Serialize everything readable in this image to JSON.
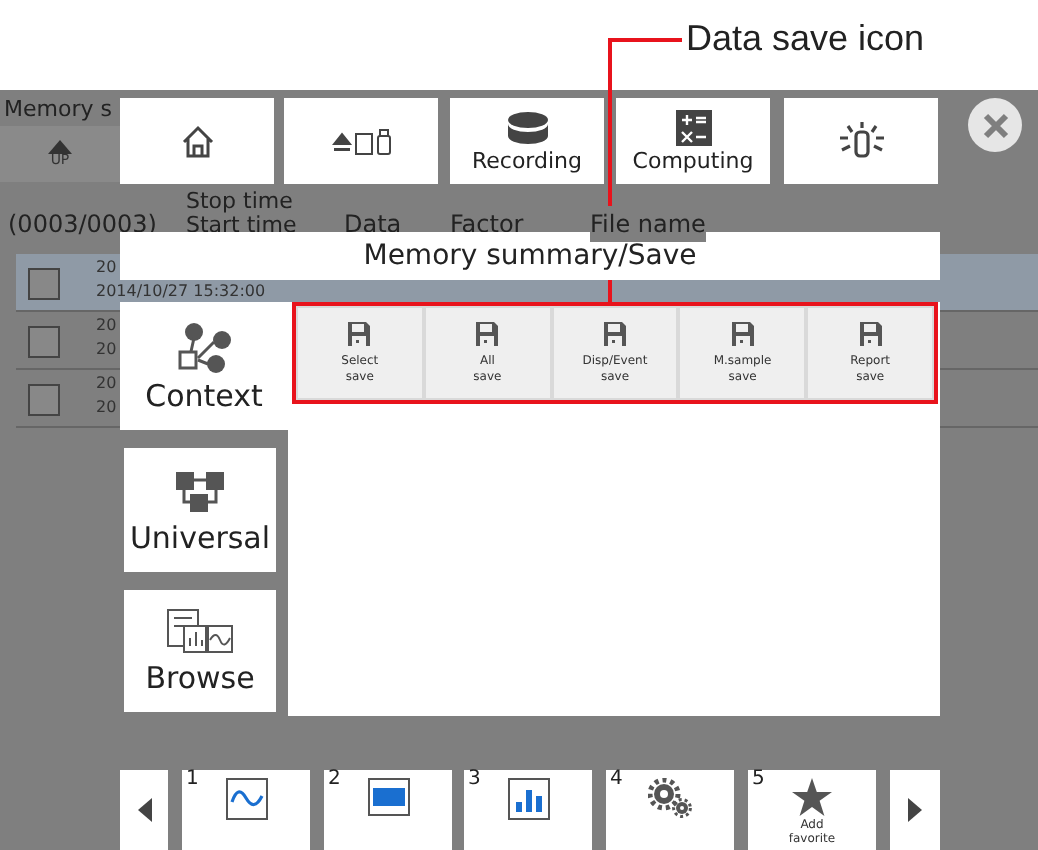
{
  "annotation": {
    "label": "Data save icon"
  },
  "background_screen": {
    "title": "Memory s",
    "up_button": "UP",
    "count": "(0003/0003)",
    "columns": [
      "Stop time",
      "Start time",
      "Data",
      "Factor",
      "File name"
    ],
    "rows": [
      {
        "stop": "20",
        "start": "2014/10/27 15:32:00",
        "selected": true
      },
      {
        "stop": "20",
        "start": "20",
        "selected": false
      },
      {
        "stop": "20",
        "start": "20",
        "selected": false
      }
    ]
  },
  "top_buttons": [
    {
      "kind": "home"
    },
    {
      "kind": "media"
    },
    {
      "kind": "recording",
      "label": "Recording"
    },
    {
      "kind": "computing",
      "label": "Computing"
    },
    {
      "kind": "light"
    }
  ],
  "dialog": {
    "title": "Memory summary/Save",
    "categories": [
      {
        "kind": "context",
        "label": "Context",
        "selected": true
      },
      {
        "kind": "universal",
        "label": "Universal",
        "selected": false
      },
      {
        "kind": "browse",
        "label": "Browse",
        "selected": false
      }
    ],
    "save_buttons": [
      {
        "line1": "Select",
        "line2": "save"
      },
      {
        "line1": "All",
        "line2": "save"
      },
      {
        "line1": "Disp/Event",
        "line2": "save"
      },
      {
        "line1": "M.sample",
        "line2": "save"
      },
      {
        "line1": "Report",
        "line2": "save"
      }
    ]
  },
  "favorites": [
    {
      "number": "1",
      "kind": "wave"
    },
    {
      "number": "2",
      "kind": "digits"
    },
    {
      "number": "3",
      "kind": "bars"
    },
    {
      "number": "4",
      "kind": "gears"
    },
    {
      "number": "5",
      "kind": "add",
      "label": "Add favorite"
    }
  ]
}
